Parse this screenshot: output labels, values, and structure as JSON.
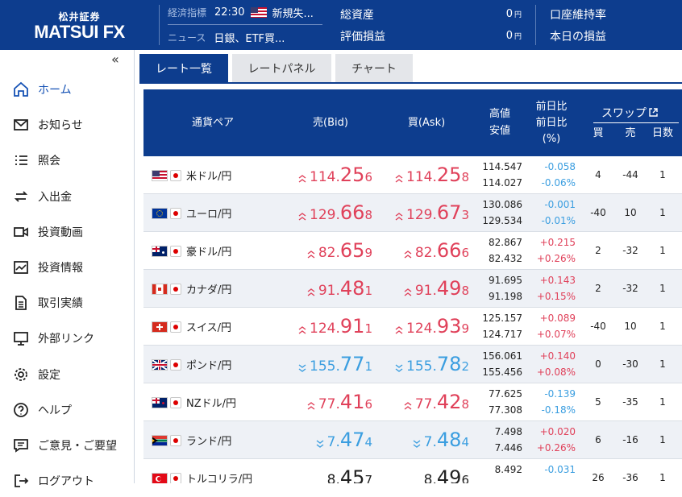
{
  "header": {
    "logo_small": "松井証券",
    "logo_big": "MATSUI FX",
    "econ_label": "経済指標",
    "econ_time": "22:30",
    "econ_text": "新規失...",
    "news_label": "ニュース",
    "news_text": "日銀、ETF買...",
    "total_assets_label": "総資産",
    "total_assets_value": "0",
    "eval_label": "評価損益",
    "eval_value": "0",
    "yen_unit": "円",
    "margin_rate_label": "口座維持率",
    "daily_pl_label": "本日の損益"
  },
  "sidebar": {
    "collapse": "«",
    "items": [
      {
        "label": "ホーム",
        "icon": "home-icon"
      },
      {
        "label": "お知らせ",
        "icon": "mail-icon"
      },
      {
        "label": "照会",
        "icon": "list-icon"
      },
      {
        "label": "入出金",
        "icon": "transfer-icon"
      },
      {
        "label": "投資動画",
        "icon": "video-icon"
      },
      {
        "label": "投資情報",
        "icon": "info-icon"
      },
      {
        "label": "取引実績",
        "icon": "document-icon"
      },
      {
        "label": "外部リンク",
        "icon": "monitor-icon"
      },
      {
        "label": "設定",
        "icon": "gear-icon"
      },
      {
        "label": "ヘルプ",
        "icon": "help-icon"
      },
      {
        "label": "ご意見・ご要望",
        "icon": "chat-icon"
      },
      {
        "label": "ログアウト",
        "icon": "logout-icon"
      }
    ]
  },
  "tabs": [
    "レート一覧",
    "レートパネル",
    "チャート"
  ],
  "table": {
    "headers": {
      "pair": "通貨ペア",
      "bid": "売(Bid)",
      "ask": "買(Ask)",
      "high": "高値",
      "low": "安値",
      "chg1": "前日比",
      "chg2": "前日比",
      "chg_pct": "(%)",
      "swap": "スワップ",
      "swap_buy": "買",
      "swap_sell": "売",
      "swap_days": "日数"
    },
    "rows": [
      {
        "flag": "us",
        "pair": "米ドル/円",
        "dir": "up",
        "bid": [
          "114.",
          "25",
          "6"
        ],
        "ask": [
          "114.",
          "25",
          "8"
        ],
        "high": "114.547",
        "low": "114.027",
        "chg": "-0.058",
        "chg_pct": "-0.06%",
        "chg_dir": "dn",
        "swap_buy": "4",
        "swap_sell": "-44",
        "days": "1"
      },
      {
        "flag": "eu",
        "pair": "ユーロ/円",
        "dir": "up",
        "bid": [
          "129.",
          "66",
          "8"
        ],
        "ask": [
          "129.",
          "67",
          "3"
        ],
        "high": "130.086",
        "low": "129.534",
        "chg": "-0.001",
        "chg_pct": "-0.01%",
        "chg_dir": "dn",
        "swap_buy": "-40",
        "swap_sell": "10",
        "days": "1"
      },
      {
        "flag": "au",
        "pair": "豪ドル/円",
        "dir": "up",
        "bid": [
          "82.",
          "65",
          "9"
        ],
        "ask": [
          "82.",
          "66",
          "6"
        ],
        "high": "82.867",
        "low": "82.432",
        "chg": "+0.215",
        "chg_pct": "+0.26%",
        "chg_dir": "up",
        "swap_buy": "2",
        "swap_sell": "-32",
        "days": "1"
      },
      {
        "flag": "ca",
        "pair": "カナダ/円",
        "dir": "up",
        "bid": [
          "91.",
          "48",
          "1"
        ],
        "ask": [
          "91.",
          "49",
          "8"
        ],
        "high": "91.695",
        "low": "91.198",
        "chg": "+0.143",
        "chg_pct": "+0.15%",
        "chg_dir": "up",
        "swap_buy": "2",
        "swap_sell": "-32",
        "days": "1"
      },
      {
        "flag": "ch",
        "pair": "スイス/円",
        "dir": "up",
        "bid": [
          "124.",
          "91",
          "1"
        ],
        "ask": [
          "124.",
          "93",
          "9"
        ],
        "high": "125.157",
        "low": "124.717",
        "chg": "+0.089",
        "chg_pct": "+0.07%",
        "chg_dir": "up",
        "swap_buy": "-40",
        "swap_sell": "10",
        "days": "1"
      },
      {
        "flag": "gb",
        "pair": "ポンド/円",
        "dir": "dn",
        "bid": [
          "155.",
          "77",
          "1"
        ],
        "ask": [
          "155.",
          "78",
          "2"
        ],
        "high": "156.061",
        "low": "155.456",
        "chg": "+0.140",
        "chg_pct": "+0.08%",
        "chg_dir": "up",
        "swap_buy": "0",
        "swap_sell": "-30",
        "days": "1"
      },
      {
        "flag": "nz",
        "pair": "NZドル/円",
        "dir": "up",
        "bid": [
          "77.",
          "41",
          "6"
        ],
        "ask": [
          "77.",
          "42",
          "8"
        ],
        "high": "77.625",
        "low": "77.308",
        "chg": "-0.139",
        "chg_pct": "-0.18%",
        "chg_dir": "dn",
        "swap_buy": "5",
        "swap_sell": "-35",
        "days": "1"
      },
      {
        "flag": "za",
        "pair": "ランド/円",
        "dir": "dn",
        "bid": [
          "7.",
          "47",
          "4"
        ],
        "ask": [
          "7.",
          "48",
          "4"
        ],
        "high": "7.498",
        "low": "7.446",
        "chg": "+0.020",
        "chg_pct": "+0.26%",
        "chg_dir": "up",
        "swap_buy": "6",
        "swap_sell": "-16",
        "days": "1"
      },
      {
        "flag": "tr",
        "pair": "トルコリラ/円",
        "dir": "none",
        "bid": [
          "8.",
          "45",
          "7"
        ],
        "ask": [
          "8.",
          "49",
          "6"
        ],
        "high": "8.492",
        "low": "",
        "chg": "-0.031",
        "chg_pct": "",
        "chg_dir": "dn",
        "swap_buy": "26",
        "swap_sell": "-36",
        "days": "1"
      }
    ]
  },
  "colors": {
    "header_bg": "#0d3d8e",
    "up": "#e0415a",
    "down": "#3b9ee0"
  }
}
